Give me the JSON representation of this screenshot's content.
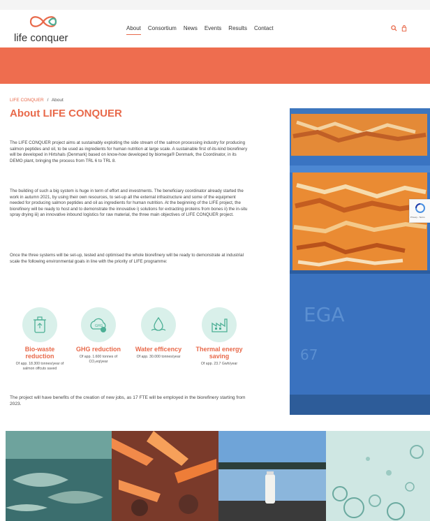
{
  "brand": {
    "name": "life conquer",
    "logo_color": "#e8694a"
  },
  "nav": {
    "items": [
      "About",
      "Consortium",
      "News",
      "Events",
      "Results",
      "Contact"
    ],
    "active": "About"
  },
  "header_icons": [
    "search-icon",
    "bag-icon"
  ],
  "colors": {
    "accent": "#e8694a",
    "banner": "#ee6d4f",
    "icon_bg": "#d9f0ea",
    "icon_stroke": "#4caf95"
  },
  "breadcrumb": {
    "home": "LIFE CONQUER",
    "sep": "/",
    "current": "About"
  },
  "page_title": "About LIFE CONQUER",
  "paragraphs": {
    "p1": "The LIFE CONQUER project aims at sustainably exploiting the side stream of the salmon processing industry for producing salmon peptides and oil, to be used as ingredients for human nutrition at large scale. A sustainable first of-its-kind biorefinery will be developed in Hirtshals (Denmark) based on know-how developed by biomega® Denmark, the Coordinator, in its DEMO plant, bringing the process from TRL 6 to TRL 8.",
    "p2": "The building of such a big system is huge in term of effort and investments. The beneficiary coordinator already started the work in autumn 2021, by using their own resources, to set-up all the external infrastructure and some of the equipment needed for producing salmon peptides and oil as ingredients for human nutrition. At the beginning of the LIFE project, the biorefinery will be ready to host and to demonstrate the innovative i) solutions for extracting proteins from bones ii) the in-situ spray drying iii) an innovative inbound logistics for raw material, the three main objectives of LIFE CONQUER project.",
    "p3": "Once the three systems will be set-up, tested and optimised the whole biorefinery will be ready to demonstrate at industrial scale the following environmental goals in line with the priority of LIFE programme:",
    "p4": "The project will have benefits of the creation of new jobs, as 17 FTE will be employed in the biorefinery starting from 2023."
  },
  "goals": [
    {
      "icon": "recycle-bin-icon",
      "title": "Bio-waste reduction",
      "desc": "Of app. 18.300 tonnes/year of salmon offcuts saved"
    },
    {
      "icon": "ghg-icon",
      "title": "GHG reduction",
      "desc": "Of app. 1.600 tonnes of CO₂eq/year"
    },
    {
      "icon": "water-drop-icon",
      "title": "Water efficency",
      "desc": "Of app. 30.000 tonnes/year"
    },
    {
      "icon": "factory-icon",
      "title": "Thermal energy saving",
      "desc": "Of app. 23.7 Gwh/year"
    }
  ],
  "photo": {
    "box_text": "EGA",
    "box_text2": "67"
  },
  "recaptcha": {
    "label": "Privacy - Terms"
  }
}
